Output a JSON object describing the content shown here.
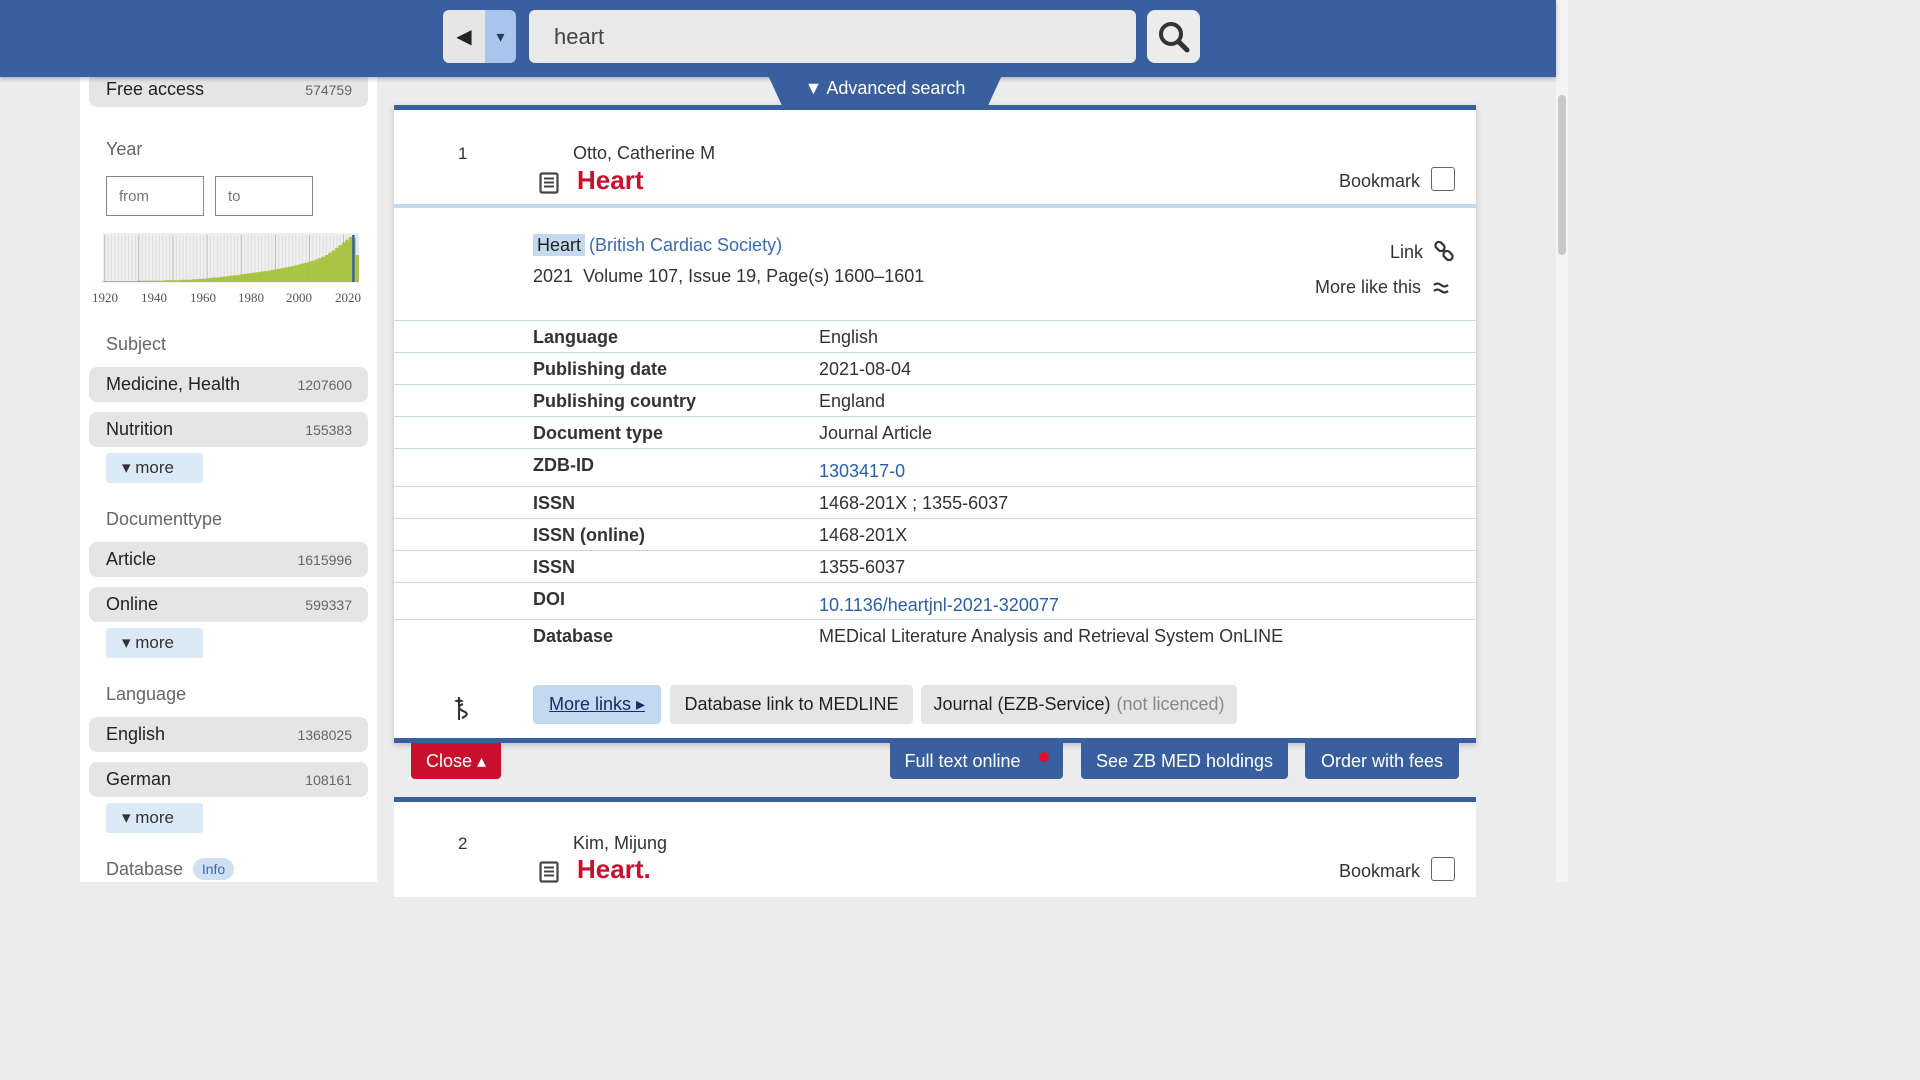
{
  "search": {
    "query": "heart",
    "advanced_label": "▼ Advanced search"
  },
  "nav": {
    "back_symbol": "◀",
    "dropdown_symbol": "▾"
  },
  "sidebar": {
    "free_access": {
      "label": "Free access",
      "count": "574759"
    },
    "year": {
      "heading": "Year",
      "from_placeholder": "from",
      "to_placeholder": "to",
      "axis_labels": [
        "1920",
        "1940",
        "1960",
        "1980",
        "2000",
        "2020"
      ],
      "histogram_relative_counts": [
        0.02,
        0.02,
        0.02,
        0.02,
        0.02,
        0.02,
        0.02,
        0.02,
        0.02,
        0.02,
        0.03,
        0.03,
        0.03,
        0.03,
        0.03,
        0.03,
        0.03,
        0.03,
        0.04,
        0.04,
        0.04,
        0.04,
        0.04,
        0.05,
        0.05,
        0.05,
        0.06,
        0.06,
        0.07,
        0.07,
        0.08,
        0.09,
        0.1,
        0.1,
        0.11,
        0.12,
        0.13,
        0.14,
        0.15,
        0.15,
        0.17,
        0.18,
        0.19,
        0.2,
        0.21,
        0.22,
        0.23,
        0.24,
        0.25,
        0.27,
        0.28,
        0.29,
        0.31,
        0.32,
        0.34,
        0.35,
        0.37,
        0.39,
        0.41,
        0.43,
        0.45,
        0.47,
        0.5,
        0.53,
        0.56,
        0.6,
        0.65,
        0.7,
        0.76,
        0.82,
        0.88,
        0.94,
        1.0,
        0.98,
        0.6
      ]
    },
    "subject": {
      "heading": "Subject",
      "items": [
        {
          "label": "Medicine, Health",
          "count": "1207600"
        },
        {
          "label": "Nutrition",
          "count": "155383"
        }
      ],
      "more": "▾ more"
    },
    "documenttype": {
      "heading": "Documenttype",
      "items": [
        {
          "label": "Article",
          "count": "1615996"
        },
        {
          "label": "Online",
          "count": "599337"
        }
      ],
      "more": "▾ more"
    },
    "language": {
      "heading": "Language",
      "items": [
        {
          "label": "English",
          "count": "1368025"
        },
        {
          "label": "German",
          "count": "108161"
        }
      ],
      "more": "▾ more"
    },
    "database": {
      "heading": "Database",
      "badge": "Info"
    }
  },
  "record1": {
    "number": "1",
    "author": "Otto, Catherine M",
    "title": "Heart",
    "bookmark_label": "Bookmark",
    "journal": "Heart",
    "journal_org": "(British Cardiac Society)",
    "year": "2021",
    "volume_info": "Volume 107, Issue 19, Page(s) 1600–1601",
    "link_label": "Link",
    "more_like_label": "More like this",
    "details": [
      {
        "key": "Language",
        "value": "English",
        "link": false
      },
      {
        "key": "Publishing date",
        "value": "2021-08-04",
        "link": false
      },
      {
        "key": "Publishing country",
        "value": "England",
        "link": false
      },
      {
        "key": "Document type",
        "value": "Journal Article",
        "link": false
      },
      {
        "key": "ZDB-ID",
        "value": "1303417-0",
        "link": true
      },
      {
        "key": "ISSN",
        "value": "1468-201X ; 1355-6037",
        "link": false
      },
      {
        "key": "ISSN (online)",
        "value": "1468-201X",
        "link": false
      },
      {
        "key": "ISSN",
        "value": "1355-6037",
        "link": false
      },
      {
        "key": "DOI",
        "value": "10.1136/heartjnl-2021-320077",
        "link": true
      },
      {
        "key": "Database",
        "value": "MEDical Literature Analysis and Retrieval System OnLINE",
        "link": false
      }
    ],
    "buttons": {
      "more_links": "More links ▸",
      "database_link": "Database link to MEDLINE",
      "journal": "Journal (EZB-Service)",
      "journal_note": "(not licenced)"
    },
    "actions": {
      "close": "Close ▴",
      "full_text": "Full text online",
      "holdings": "See ZB MED holdings",
      "order": "Order with fees"
    }
  },
  "record2": {
    "number": "2",
    "author": "Kim, Mijung",
    "title": "Heart.",
    "bookmark_label": "Bookmark"
  },
  "colors": {
    "brand_blue": "#3a5f9e",
    "accent_red": "#c8102e",
    "link_blue": "#2a5fa6",
    "highlight": "#c3d9f0"
  }
}
